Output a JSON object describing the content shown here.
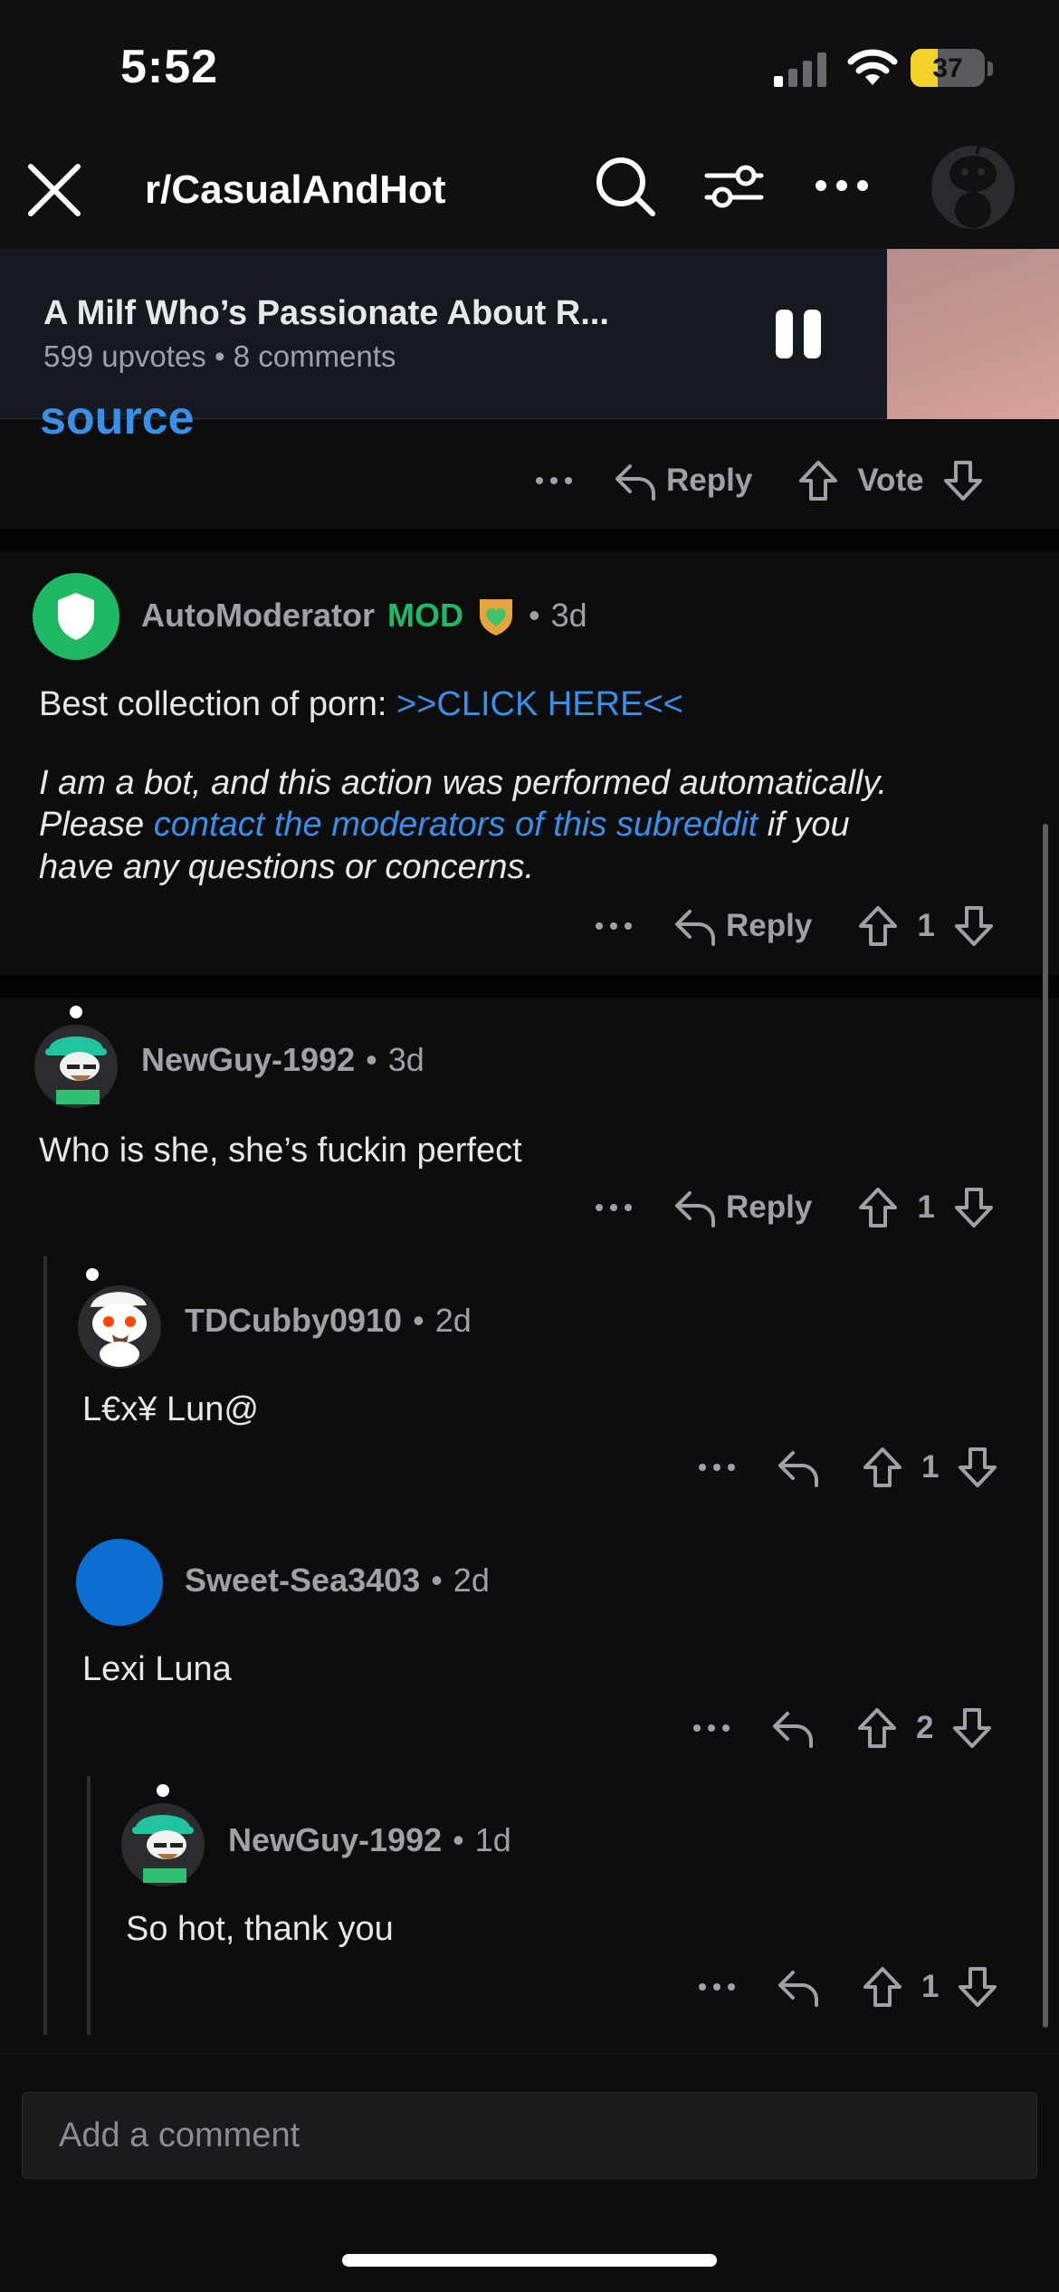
{
  "status_bar": {
    "time": "5:52",
    "battery": "37"
  },
  "nav": {
    "title": "r/CasualAndHot"
  },
  "pinned_post": {
    "title": "A Milf Who’s Passionate About R...",
    "meta": "599 upvotes • 8 comments"
  },
  "top_actions": {
    "source_peek": "source",
    "reply": "Reply",
    "vote": "Vote"
  },
  "comments": [
    {
      "user": "AutoModerator",
      "mod_badge": "MOD",
      "age": "3d",
      "line1_prefix": "Best collection of porn: ",
      "line1_link": ">>CLICK HERE<<",
      "line2": "I am a bot, and this action was performed automatically.",
      "line3_prefix": "Please ",
      "line3_link": "contact the moderators of this subreddit",
      "line3_suffix": " if you",
      "line4": "have any questions or concerns.",
      "reply": "Reply",
      "votes": "1"
    },
    {
      "user": "NewGuy-1992",
      "age": "3d",
      "text": "Who is she, she’s fuckin perfect",
      "reply": "Reply",
      "votes": "1"
    },
    {
      "user": "TDCubby0910",
      "age": "2d",
      "text": "L€x¥ Lun@",
      "votes": "1"
    },
    {
      "user": "Sweet-Sea3403",
      "age": "2d",
      "text": "Lexi Luna",
      "votes": "2",
      "avatar_color": "#0a6fd1"
    },
    {
      "user": "NewGuy-1992",
      "age": "1d",
      "text": "So hot, thank you",
      "votes": "1"
    }
  ],
  "composer": {
    "placeholder": "Add a comment"
  },
  "colors": {
    "link": "#3a8fe8",
    "mod": "#1fb964",
    "shield": "#1fb964"
  }
}
